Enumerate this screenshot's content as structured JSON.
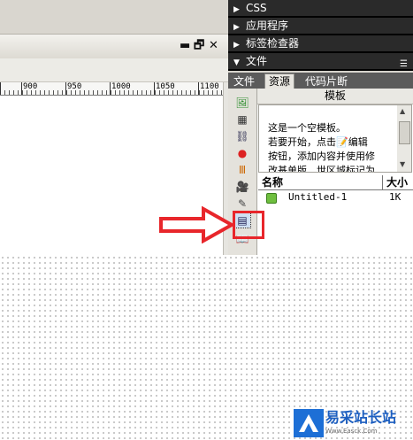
{
  "document_window": {
    "restore_symbol": "▬",
    "maximize_symbol": "🗗",
    "close_symbol": "✕",
    "ruler_labels": [
      "900",
      "950",
      "1000",
      "1050",
      "1100"
    ]
  },
  "panel_groups": {
    "css": {
      "label": "CSS",
      "expanded": false
    },
    "app": {
      "label": "应用程序",
      "expanded": false
    },
    "tag_inspector": {
      "label": "标签检查器",
      "expanded": false
    },
    "files": {
      "label": "文件",
      "expanded": true
    }
  },
  "tabs": [
    {
      "label": "文件",
      "active": false
    },
    {
      "label": "资源",
      "active": true
    },
    {
      "label": "代码片断",
      "active": false
    }
  ],
  "assets": {
    "category_title": "模板",
    "preview_lines": [
      "这是一个空模板。",
      "若要开始，点击📝编辑",
      "按钮，添加内容并使用修",
      "改基单版…世区城标记为"
    ],
    "column_name": "名称",
    "column_size": "大小",
    "rows": [
      {
        "name": "Untitled-1",
        "size": "1K"
      }
    ]
  },
  "asset_categories": [
    "images-icon",
    "colors-icon",
    "urls-icon",
    "flash-icon",
    "shockwave-icon",
    "movies-icon",
    "scripts-icon",
    "templates-icon",
    "library-icon"
  ],
  "watermark": {
    "text": "易采站长站",
    "sub": "Www.Easck.Com"
  },
  "colors": {
    "panel_header": "#2a2a2a",
    "annotation_red": "#e8262b",
    "watermark_blue": "#1d5fc0"
  }
}
